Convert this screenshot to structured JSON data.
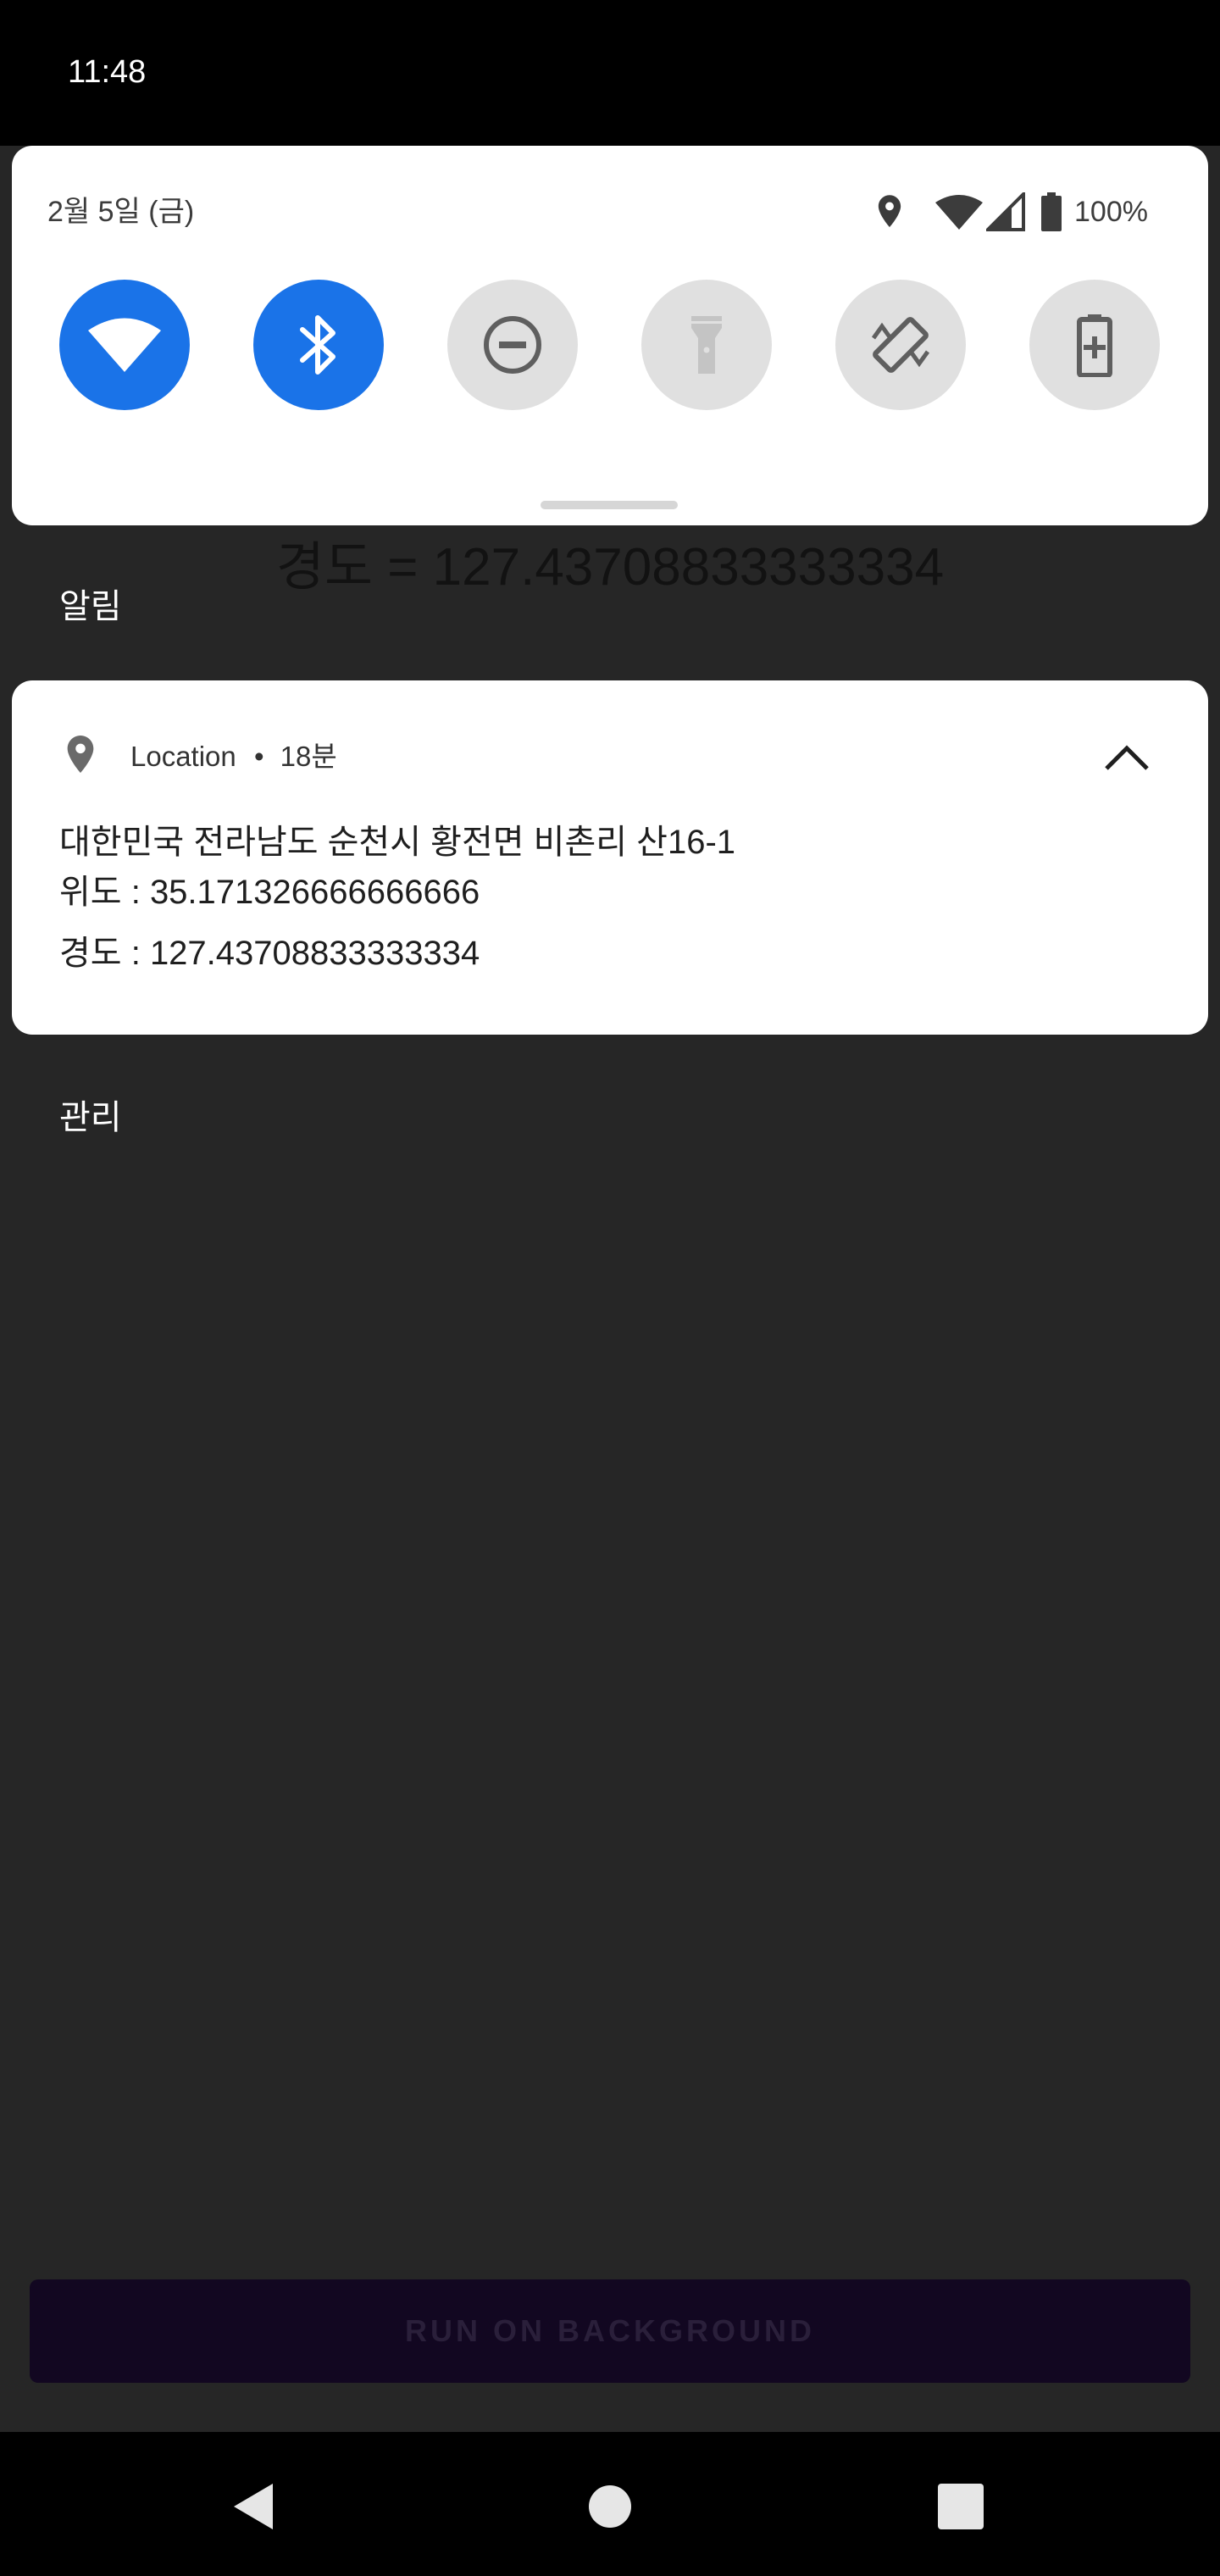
{
  "status_bar": {
    "time": "11:48"
  },
  "quick_settings": {
    "date": "2월 5일 (금)",
    "battery_percent": "100%",
    "tiles": [
      {
        "name": "wifi",
        "active": true
      },
      {
        "name": "bluetooth",
        "active": true
      },
      {
        "name": "do-not-disturb",
        "active": false
      },
      {
        "name": "flashlight",
        "active": false
      },
      {
        "name": "auto-rotate",
        "active": false
      },
      {
        "name": "battery-saver",
        "active": false
      }
    ],
    "colors": {
      "tile_active": "#1a73e8",
      "tile_inactive": "#e0e0e0"
    }
  },
  "background_app": {
    "longitude_text": "경도 = 127.43708833333334",
    "button_label": "RUN ON BACKGROUND"
  },
  "notifications": {
    "section_title": "알림",
    "card": {
      "app_name": "Location",
      "separator": "•",
      "time_ago": "18분",
      "address": "대한민국 전라남도 순천시 황전면 비촌리 산16-1",
      "latitude": "위도 : 35.171326666666666",
      "longitude": "경도 : 127.43708833333334"
    },
    "manage_label": "관리"
  },
  "navigation_bar": {
    "buttons": [
      "back",
      "home",
      "recents"
    ]
  }
}
